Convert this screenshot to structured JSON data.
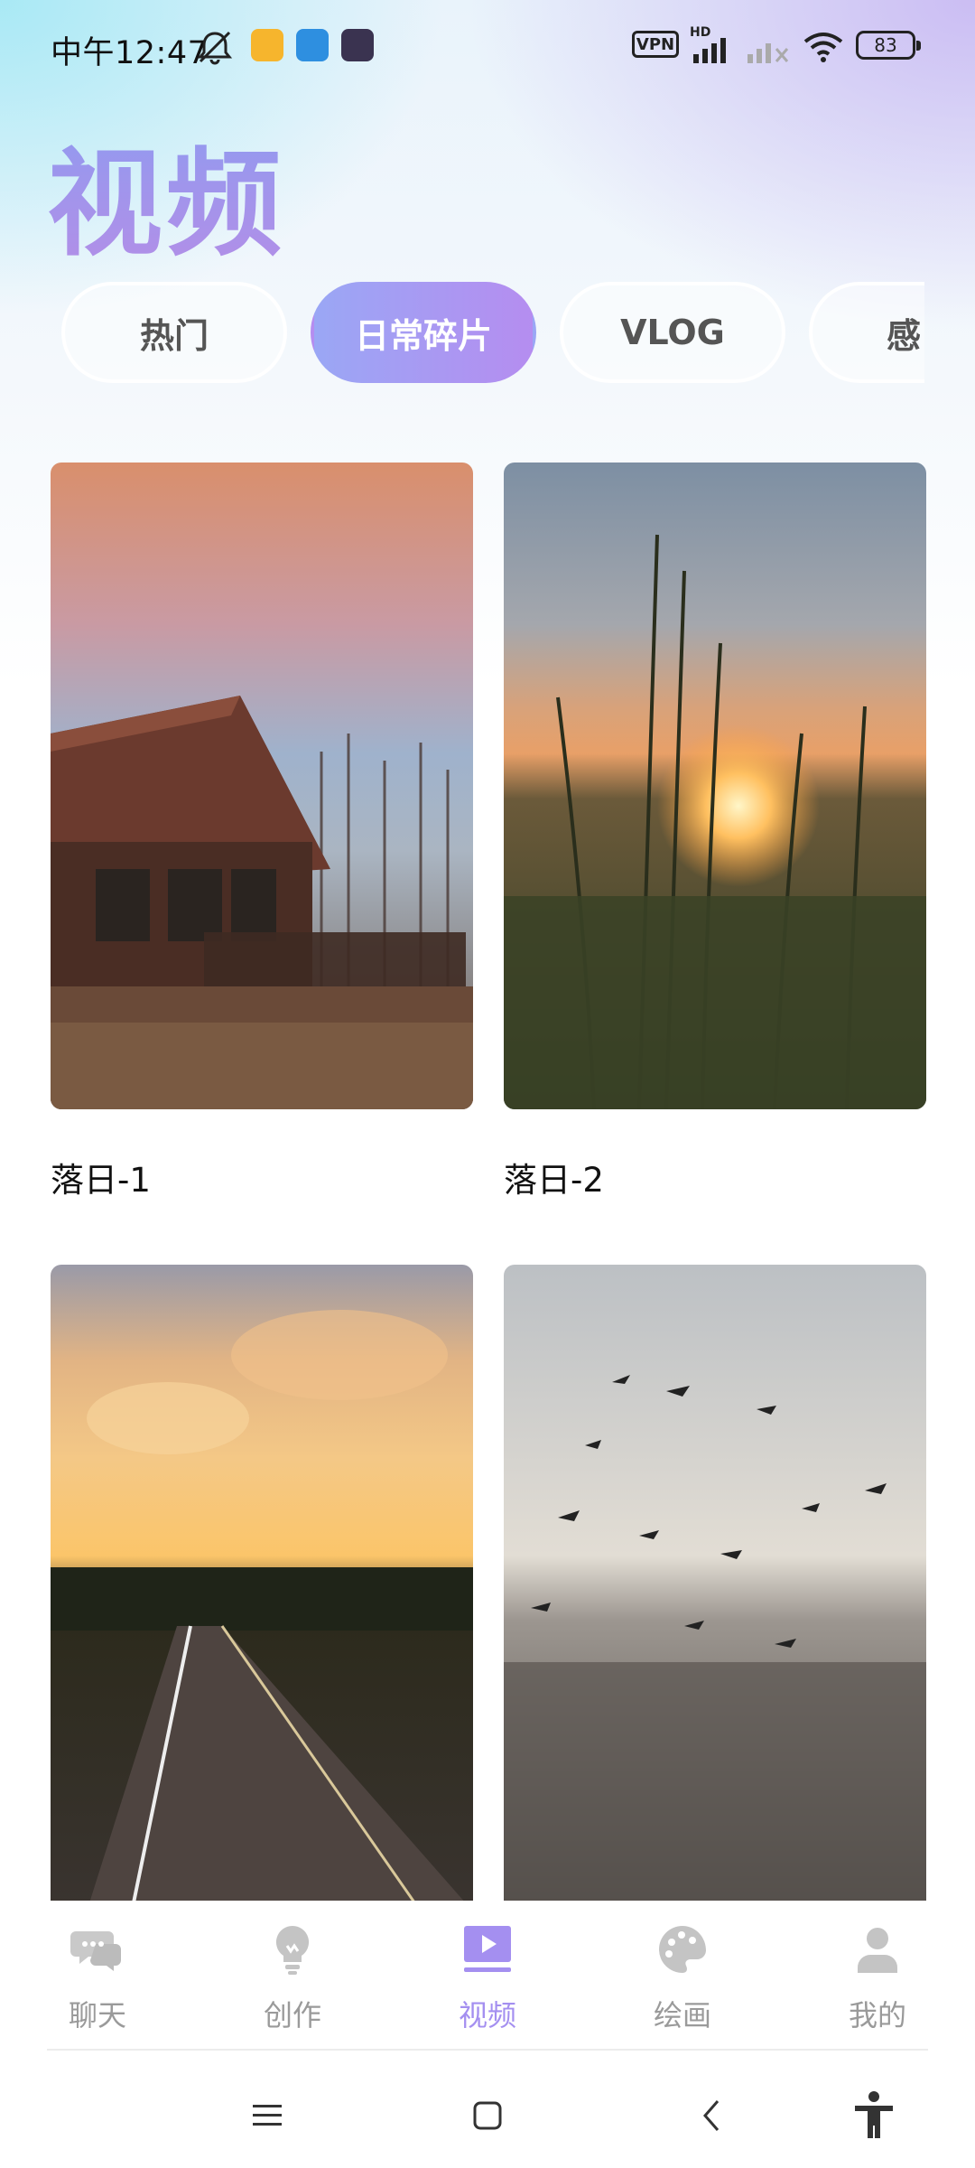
{
  "status_bar": {
    "time": "中午12:47",
    "vpn_label": "VPN",
    "network_label": "HD",
    "battery_level": "83",
    "icons": [
      "mute-icon",
      "app-notification-icon",
      "app-notification-icon",
      "app-notification-icon",
      "vpn-icon",
      "signal-icon",
      "signal-icon",
      "wifi-icon",
      "battery-icon"
    ]
  },
  "page": {
    "title": "视频"
  },
  "tabs": [
    {
      "label": "热门",
      "active": false
    },
    {
      "label": "日常碎片",
      "active": true
    },
    {
      "label": "VLOG",
      "active": false
    },
    {
      "label": "感",
      "active": false
    }
  ],
  "videos": [
    {
      "title": "落日-1",
      "thumbnail": "log cabin at sunset"
    },
    {
      "title": "落日-2",
      "thumbnail": "reeds against setting sun"
    },
    {
      "title": "",
      "thumbnail": "road at golden sunset"
    },
    {
      "title": "",
      "thumbnail": "seagulls over water"
    }
  ],
  "bottom_nav": [
    {
      "label": "聊天",
      "icon": "chat-icon",
      "active": false
    },
    {
      "label": "创作",
      "icon": "lightbulb-icon",
      "active": false
    },
    {
      "label": "视频",
      "icon": "video-play-icon",
      "active": true
    },
    {
      "label": "绘画",
      "icon": "palette-icon",
      "active": false
    },
    {
      "label": "我的",
      "icon": "person-icon",
      "active": false
    }
  ],
  "system_nav": [
    "menu-icon",
    "home-icon",
    "back-icon",
    "accessibility-icon"
  ],
  "colors": {
    "accent": "#a48ff0",
    "accent_start": "#9aa7f5",
    "inactive": "#9a9a9a"
  }
}
